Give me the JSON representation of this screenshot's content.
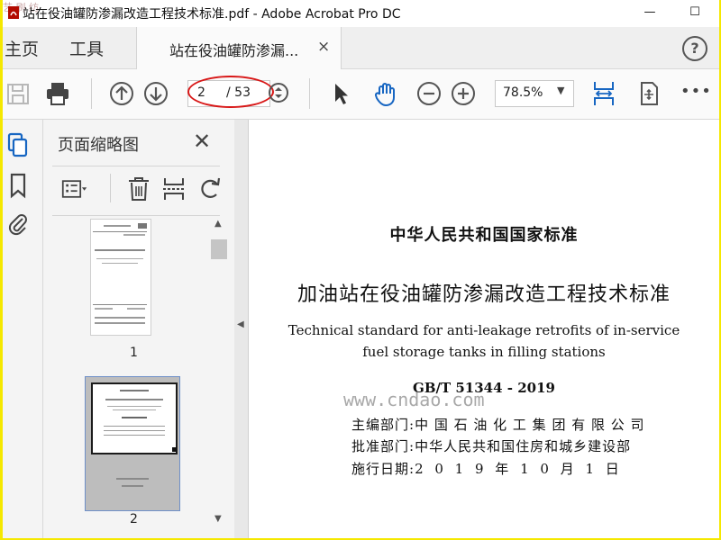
{
  "window": {
    "title": "站在役油罐防渗漏改造工程技术标准.pdf - Adobe Acrobat Pro DC",
    "minimize": "—",
    "maximize": "☐",
    "close": "✕"
  },
  "nav": {
    "home": "主页",
    "tools": "工具",
    "document_tab": "站在役油罐防渗漏...",
    "tab_close": "×",
    "help": "?"
  },
  "toolbar": {
    "current_page": "2",
    "total_pages": "/ 53",
    "zoom": "78.5%",
    "more": "•••"
  },
  "thumbnails_panel": {
    "title": "页面缩略图",
    "close": "✕",
    "pages": [
      {
        "number": "1",
        "selected": false
      },
      {
        "number": "2",
        "selected": true
      }
    ]
  },
  "document_page": {
    "national_standard": "中华人民共和国国家标准",
    "title_cn": "加油站在役油罐防渗漏改造工程技术标准",
    "title_en_line1": "Technical standard for anti-leakage retrofits of in-service",
    "title_en_line2": "fuel storage tanks in filling stations",
    "code": "GB/T 51344 - 2019",
    "dept_label": "主编部门:",
    "dept_value": "中 国 石 油 化 工 集 团 有 限 公 司",
    "approve_label": "批准部门:",
    "approve_value": "中华人民共和国住房和城乡建设部",
    "date_label": "施行日期:",
    "date_value": "2 0 1 9  年  1 0  月  1  日"
  },
  "watermark": "www.cndao.com",
  "corner_watermark": "艺 刷 纺"
}
